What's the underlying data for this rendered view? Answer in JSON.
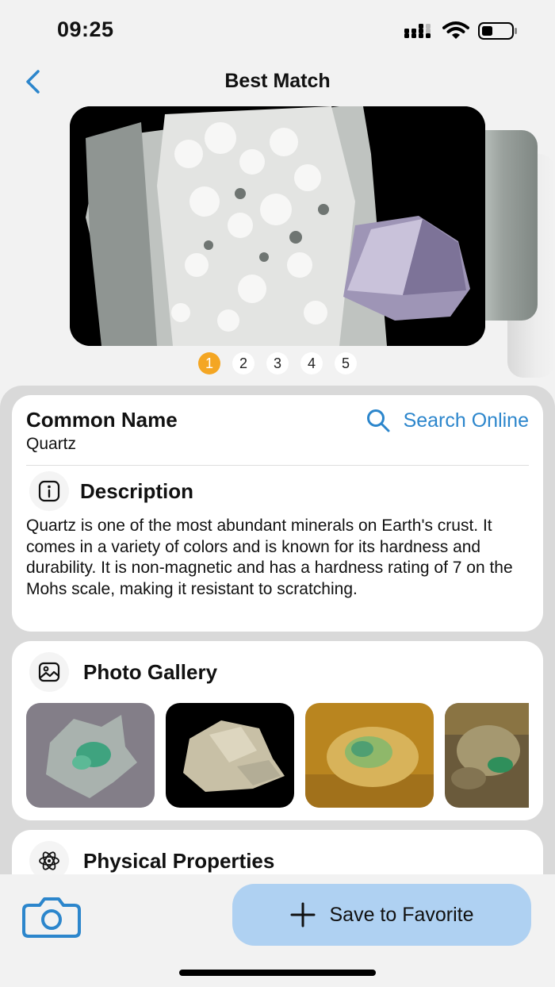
{
  "status_bar": {
    "time": "09:25",
    "icons": [
      "signal-icon",
      "wifi-icon",
      "battery-icon"
    ]
  },
  "nav": {
    "title": "Best Match",
    "back_icon": "chevron-left-icon"
  },
  "hero": {
    "pages": [
      "1",
      "2",
      "3",
      "4",
      "5"
    ],
    "active_page": "1"
  },
  "identification": {
    "common_name_label": "Common Name",
    "common_name_value": "Quartz",
    "search_label": "Search Online"
  },
  "description": {
    "title": "Description",
    "text": "Quartz is one of the most abundant minerals on Earth's crust. It comes in a variety of colors and is known for its hardness and durability. It is non-magnetic and has a hardness rating of 7 on the Mohs scale, making it resistant to scratching."
  },
  "gallery": {
    "title": "Photo Gallery"
  },
  "properties": {
    "title": "Physical Properties"
  },
  "bottom": {
    "save_label": "Save to Favorite",
    "camera_icon": "camera-icon"
  },
  "colors": {
    "accent": "#2c86cc",
    "active_page": "#f4a623",
    "save_button": "#afd1f2"
  }
}
